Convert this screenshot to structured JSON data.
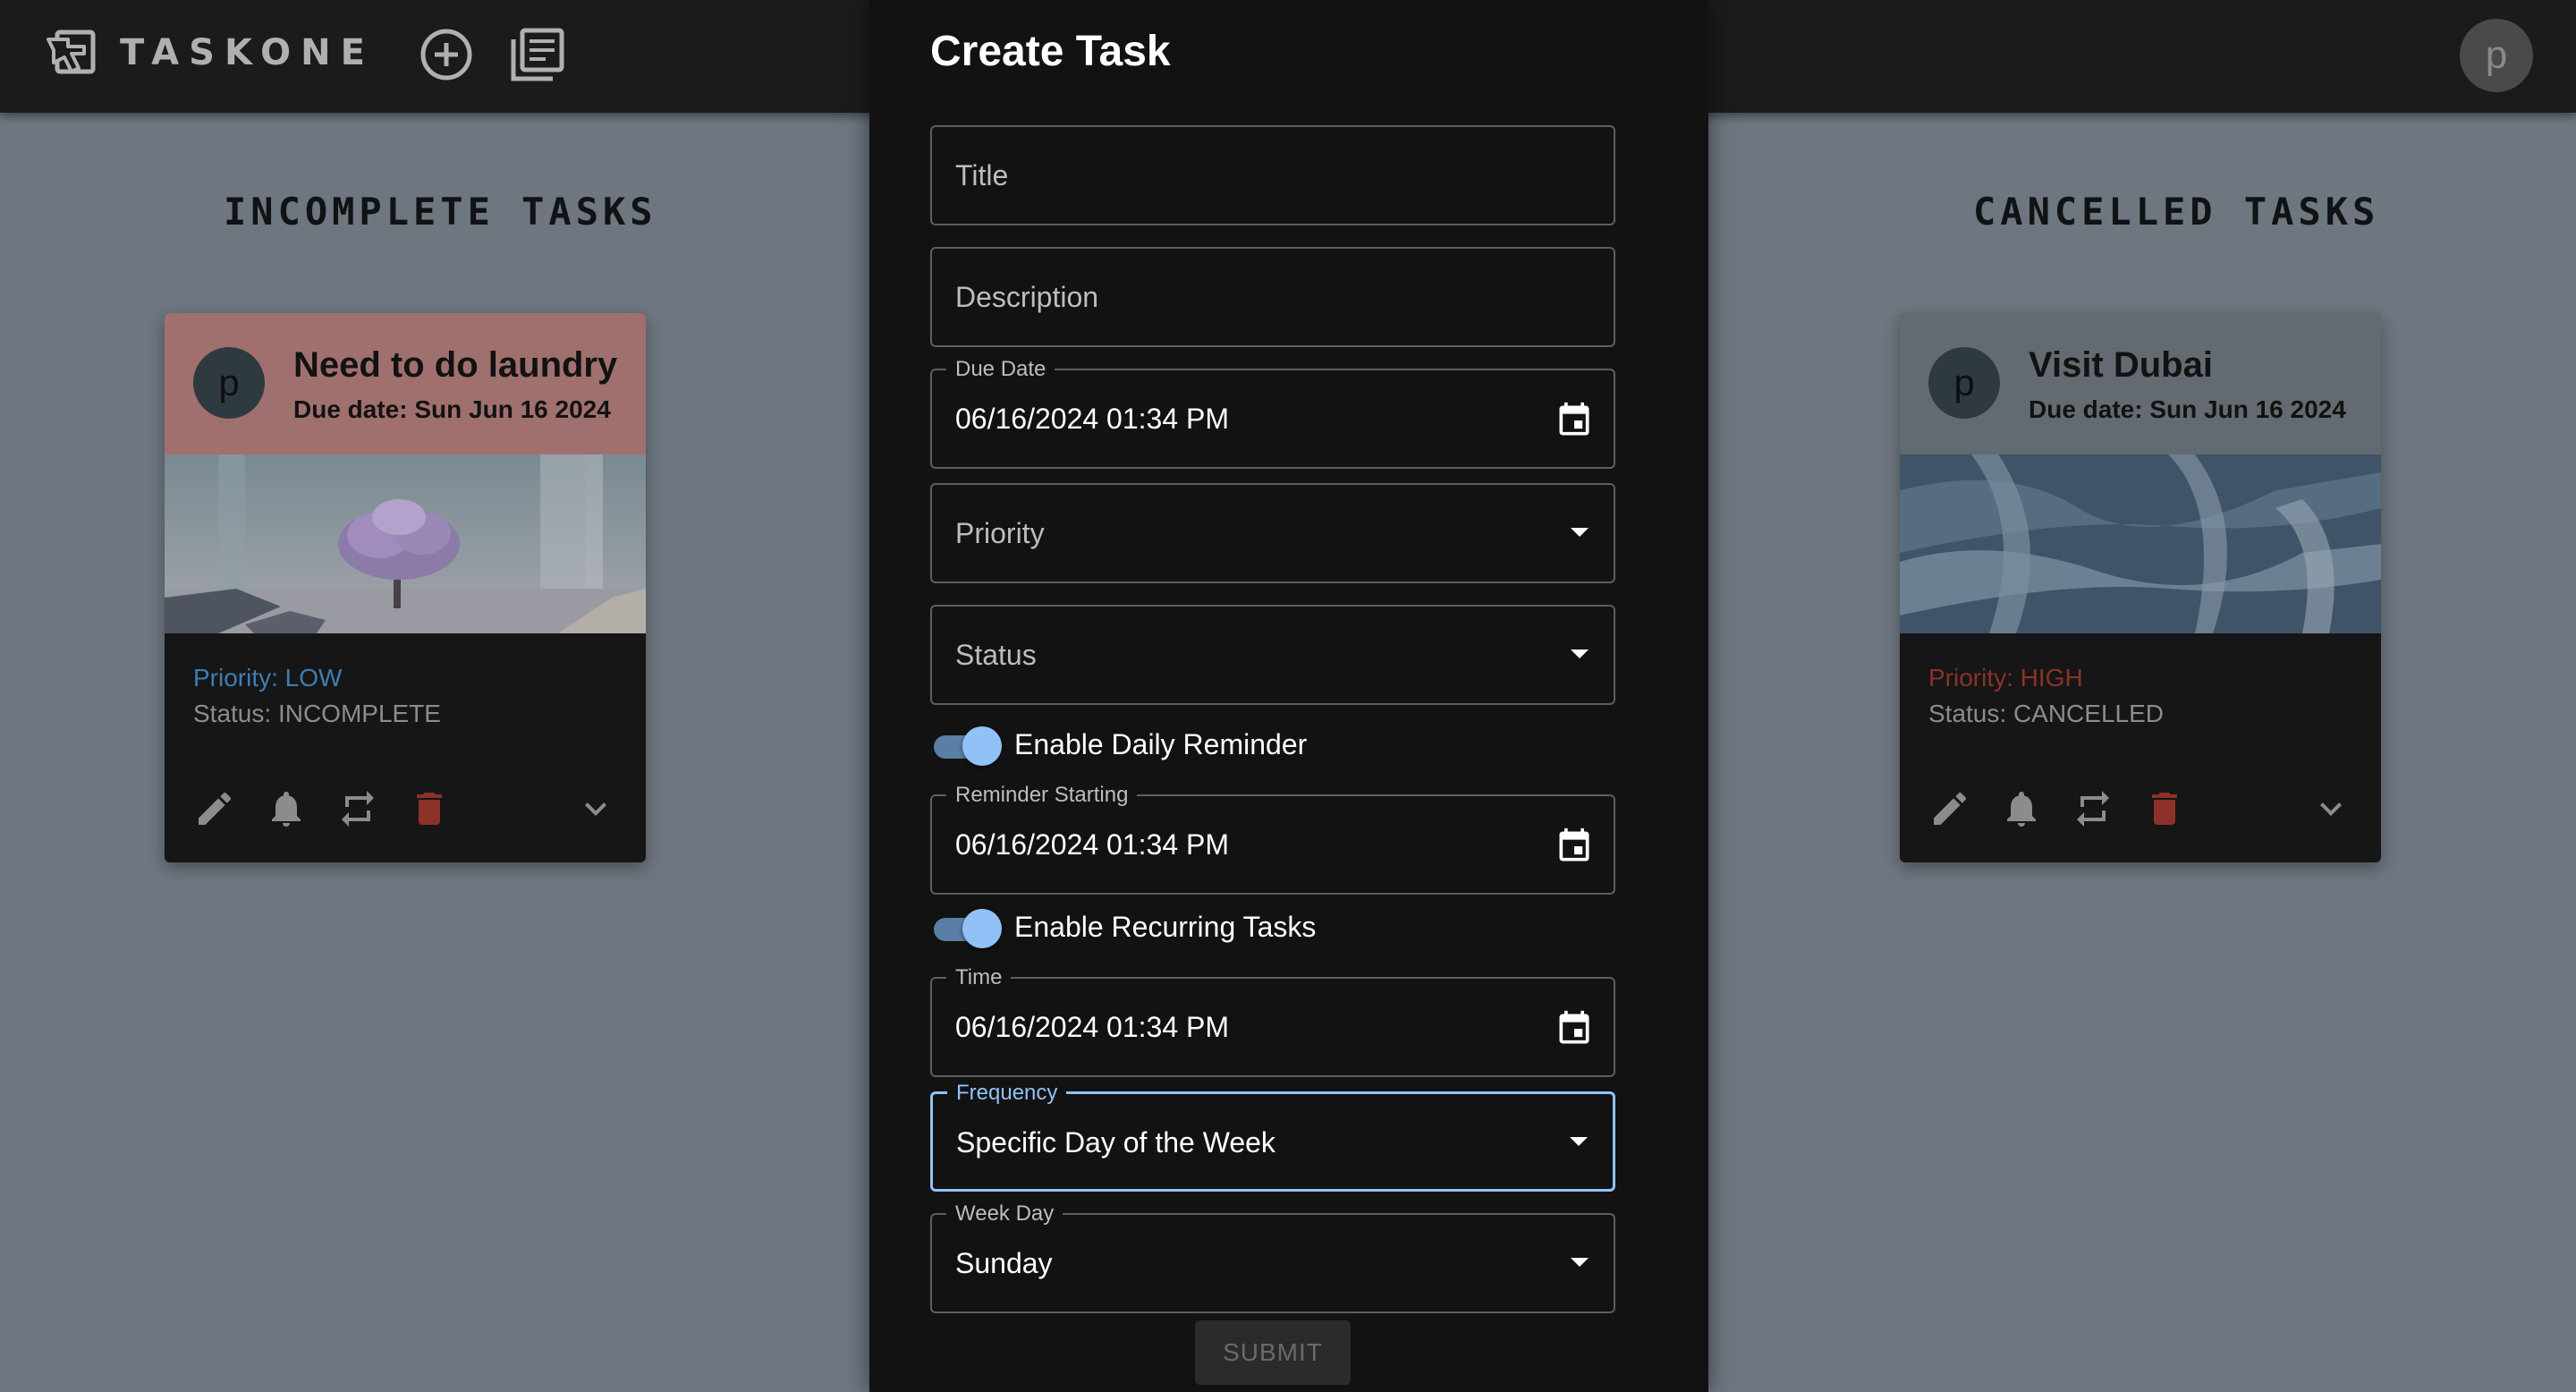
{
  "app": {
    "brand": "TASKONE",
    "logo_icon": "hand-pointer-icon",
    "add_icon": "add-circle-icon",
    "list_icon": "task-list-icon",
    "user_initial": "p"
  },
  "sections": {
    "incomplete_title": "INCOMPLETE TASKS",
    "cancelled_title": "CANCELLED TASKS"
  },
  "cards": {
    "incomplete": {
      "avatar": "p",
      "title": "Need to do laundry",
      "due": "Due date: Sun Jun 16 2024",
      "priority": "Priority: LOW",
      "status": "Status: INCOMPLETE",
      "header_color": "#a0706e",
      "priority_color": "#3e7db3"
    },
    "cancelled": {
      "avatar": "p",
      "title": "Visit Dubai",
      "due": "Due date: Sun Jun 16 2024",
      "priority": "Priority: HIGH",
      "status": "Status: CANCELLED",
      "header_color": "#636a72",
      "priority_color": "#8c3228"
    },
    "action_icons": [
      "edit-icon",
      "bell-icon",
      "repeat-icon",
      "delete-icon",
      "expand-more-icon"
    ]
  },
  "modal": {
    "title": "Create Task",
    "title_placeholder": "Title",
    "description_placeholder": "Description",
    "due_date_label": "Due Date",
    "due_date_value": "06/16/2024 01:34 PM",
    "priority_placeholder": "Priority",
    "status_placeholder": "Status",
    "daily_reminder_label": "Enable Daily Reminder",
    "daily_reminder_on": true,
    "reminder_starting_label": "Reminder Starting",
    "reminder_starting_value": "06/16/2024 01:34 PM",
    "recurring_label": "Enable Recurring Tasks",
    "recurring_on": true,
    "time_label": "Time",
    "time_value": "06/16/2024 01:34 PM",
    "frequency_label": "Frequency",
    "frequency_value": "Specific Day of the Week",
    "weekday_label": "Week Day",
    "weekday_value": "Sunday",
    "submit_label": "SUBMIT",
    "accent_color": "#90c2f8"
  }
}
